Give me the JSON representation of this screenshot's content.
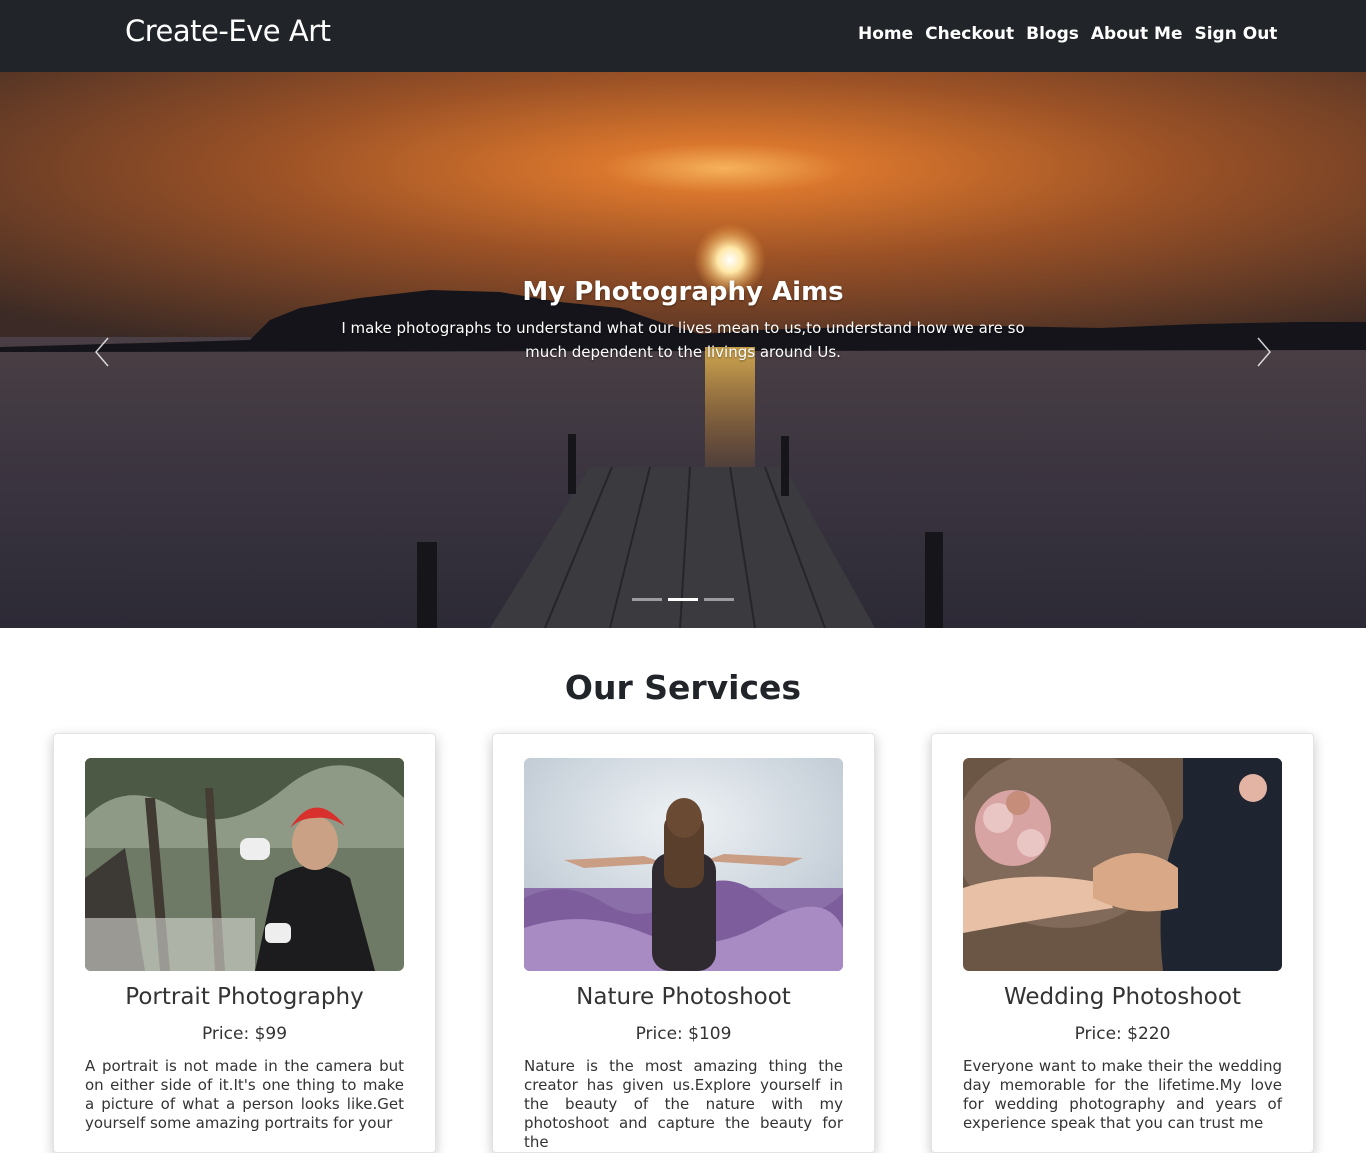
{
  "navbar": {
    "brand": "Create-Eve Art",
    "links": [
      "Home",
      "Checkout",
      "Blogs",
      "About Me",
      "Sign Out"
    ]
  },
  "hero": {
    "title": "My Photography Aims",
    "text": "I make photographs to understand what our lives mean to us,to understand how we are so much dependent to the livings around Us.",
    "slide_count": 3,
    "active_slide": 2
  },
  "services": {
    "heading": "Our Services",
    "cards": [
      {
        "title": "Portrait Photography",
        "price": "Price: $99",
        "text": "A portrait is not made in the camera but on either side of it.It's one thing to make a picture of what a person looks like.Get yourself some amazing portraits for your"
      },
      {
        "title": "Nature Photoshoot",
        "price": "Price: $109",
        "text": "Nature is the most amazing thing the creator has given us.Explore yourself in the beauty of the nature with my photoshoot and capture the beauty for the"
      },
      {
        "title": "Wedding Photoshoot",
        "price": "Price: $220",
        "text": "Everyone want to make their the wedding day memorable for the lifetime.My love for wedding photography and years of experience speak that you can trust me"
      }
    ]
  },
  "colors": {
    "navbar_bg": "#212529",
    "text_dark": "#212529",
    "sunset_orange": "#c76a2a"
  },
  "icons": [
    "chevron-left-icon",
    "chevron-right-icon"
  ]
}
